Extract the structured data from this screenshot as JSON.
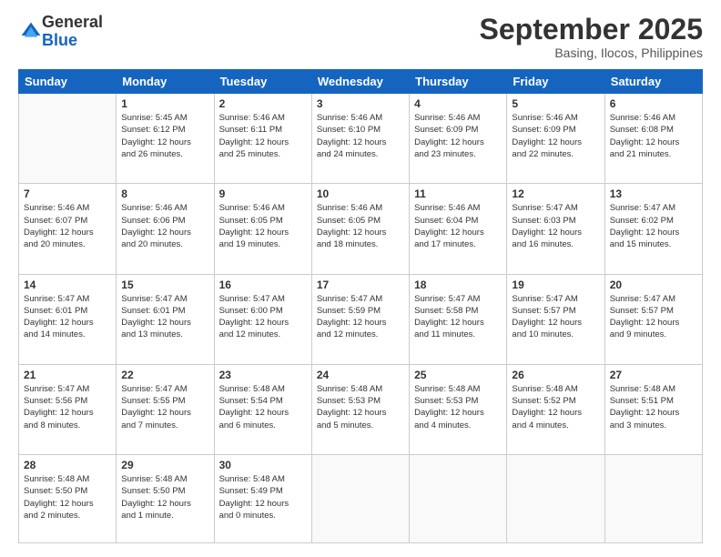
{
  "logo": {
    "general": "General",
    "blue": "Blue"
  },
  "title": "September 2025",
  "location": "Basing, Ilocos, Philippines",
  "headers": [
    "Sunday",
    "Monday",
    "Tuesday",
    "Wednesday",
    "Thursday",
    "Friday",
    "Saturday"
  ],
  "weeks": [
    [
      {
        "day": "",
        "info": ""
      },
      {
        "day": "1",
        "info": "Sunrise: 5:45 AM\nSunset: 6:12 PM\nDaylight: 12 hours\nand 26 minutes."
      },
      {
        "day": "2",
        "info": "Sunrise: 5:46 AM\nSunset: 6:11 PM\nDaylight: 12 hours\nand 25 minutes."
      },
      {
        "day": "3",
        "info": "Sunrise: 5:46 AM\nSunset: 6:10 PM\nDaylight: 12 hours\nand 24 minutes."
      },
      {
        "day": "4",
        "info": "Sunrise: 5:46 AM\nSunset: 6:09 PM\nDaylight: 12 hours\nand 23 minutes."
      },
      {
        "day": "5",
        "info": "Sunrise: 5:46 AM\nSunset: 6:09 PM\nDaylight: 12 hours\nand 22 minutes."
      },
      {
        "day": "6",
        "info": "Sunrise: 5:46 AM\nSunset: 6:08 PM\nDaylight: 12 hours\nand 21 minutes."
      }
    ],
    [
      {
        "day": "7",
        "info": "Sunrise: 5:46 AM\nSunset: 6:07 PM\nDaylight: 12 hours\nand 20 minutes."
      },
      {
        "day": "8",
        "info": "Sunrise: 5:46 AM\nSunset: 6:06 PM\nDaylight: 12 hours\nand 20 minutes."
      },
      {
        "day": "9",
        "info": "Sunrise: 5:46 AM\nSunset: 6:05 PM\nDaylight: 12 hours\nand 19 minutes."
      },
      {
        "day": "10",
        "info": "Sunrise: 5:46 AM\nSunset: 6:05 PM\nDaylight: 12 hours\nand 18 minutes."
      },
      {
        "day": "11",
        "info": "Sunrise: 5:46 AM\nSunset: 6:04 PM\nDaylight: 12 hours\nand 17 minutes."
      },
      {
        "day": "12",
        "info": "Sunrise: 5:47 AM\nSunset: 6:03 PM\nDaylight: 12 hours\nand 16 minutes."
      },
      {
        "day": "13",
        "info": "Sunrise: 5:47 AM\nSunset: 6:02 PM\nDaylight: 12 hours\nand 15 minutes."
      }
    ],
    [
      {
        "day": "14",
        "info": "Sunrise: 5:47 AM\nSunset: 6:01 PM\nDaylight: 12 hours\nand 14 minutes."
      },
      {
        "day": "15",
        "info": "Sunrise: 5:47 AM\nSunset: 6:01 PM\nDaylight: 12 hours\nand 13 minutes."
      },
      {
        "day": "16",
        "info": "Sunrise: 5:47 AM\nSunset: 6:00 PM\nDaylight: 12 hours\nand 12 minutes."
      },
      {
        "day": "17",
        "info": "Sunrise: 5:47 AM\nSunset: 5:59 PM\nDaylight: 12 hours\nand 12 minutes."
      },
      {
        "day": "18",
        "info": "Sunrise: 5:47 AM\nSunset: 5:58 PM\nDaylight: 12 hours\nand 11 minutes."
      },
      {
        "day": "19",
        "info": "Sunrise: 5:47 AM\nSunset: 5:57 PM\nDaylight: 12 hours\nand 10 minutes."
      },
      {
        "day": "20",
        "info": "Sunrise: 5:47 AM\nSunset: 5:57 PM\nDaylight: 12 hours\nand 9 minutes."
      }
    ],
    [
      {
        "day": "21",
        "info": "Sunrise: 5:47 AM\nSunset: 5:56 PM\nDaylight: 12 hours\nand 8 minutes."
      },
      {
        "day": "22",
        "info": "Sunrise: 5:47 AM\nSunset: 5:55 PM\nDaylight: 12 hours\nand 7 minutes."
      },
      {
        "day": "23",
        "info": "Sunrise: 5:48 AM\nSunset: 5:54 PM\nDaylight: 12 hours\nand 6 minutes."
      },
      {
        "day": "24",
        "info": "Sunrise: 5:48 AM\nSunset: 5:53 PM\nDaylight: 12 hours\nand 5 minutes."
      },
      {
        "day": "25",
        "info": "Sunrise: 5:48 AM\nSunset: 5:53 PM\nDaylight: 12 hours\nand 4 minutes."
      },
      {
        "day": "26",
        "info": "Sunrise: 5:48 AM\nSunset: 5:52 PM\nDaylight: 12 hours\nand 4 minutes."
      },
      {
        "day": "27",
        "info": "Sunrise: 5:48 AM\nSunset: 5:51 PM\nDaylight: 12 hours\nand 3 minutes."
      }
    ],
    [
      {
        "day": "28",
        "info": "Sunrise: 5:48 AM\nSunset: 5:50 PM\nDaylight: 12 hours\nand 2 minutes."
      },
      {
        "day": "29",
        "info": "Sunrise: 5:48 AM\nSunset: 5:50 PM\nDaylight: 12 hours\nand 1 minute."
      },
      {
        "day": "30",
        "info": "Sunrise: 5:48 AM\nSunset: 5:49 PM\nDaylight: 12 hours\nand 0 minutes."
      },
      {
        "day": "",
        "info": ""
      },
      {
        "day": "",
        "info": ""
      },
      {
        "day": "",
        "info": ""
      },
      {
        "day": "",
        "info": ""
      }
    ]
  ]
}
